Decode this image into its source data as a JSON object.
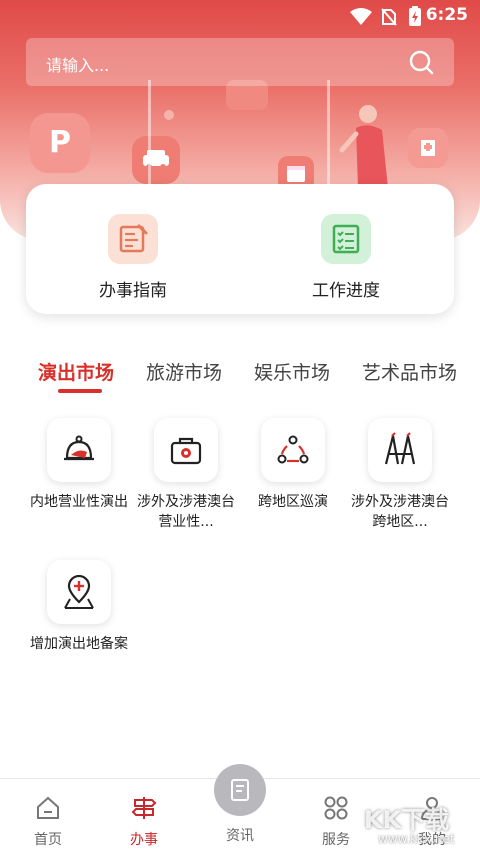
{
  "status_bar": {
    "time": "6:25"
  },
  "search": {
    "placeholder": "请输入..."
  },
  "quick_actions": [
    {
      "label": "办事指南",
      "icon": "guide-icon"
    },
    {
      "label": "工作进度",
      "icon": "progress-icon"
    }
  ],
  "tabs": [
    {
      "label": "演出市场",
      "active": true
    },
    {
      "label": "旅游市场"
    },
    {
      "label": "娱乐市场"
    },
    {
      "label": "艺术品市场"
    }
  ],
  "services": [
    {
      "label": "内地营业性演出",
      "icon": "bell-performance-icon"
    },
    {
      "label": "涉外及涉港澳台营业性...",
      "icon": "suitcase-icon"
    },
    {
      "label": "跨地区巡演",
      "icon": "cycle-nodes-icon"
    },
    {
      "label": "涉外及涉港澳台跨地区...",
      "icon": "tower-icon"
    },
    {
      "label": "增加演出地备案",
      "icon": "location-plus-icon"
    }
  ],
  "bottom_nav": [
    {
      "label": "首页",
      "icon": "home-icon"
    },
    {
      "label": "办事",
      "icon": "signpost-icon",
      "active": true
    },
    {
      "label": "资讯",
      "icon": "document-icon"
    },
    {
      "label": "服务",
      "icon": "grid-icon"
    },
    {
      "label": "我的",
      "icon": "user-icon"
    }
  ],
  "watermark": {
    "text": "KK下载",
    "url": "www.kkx.net"
  },
  "colors": {
    "accent": "#d8312b",
    "hero_top": "#e04a48"
  }
}
